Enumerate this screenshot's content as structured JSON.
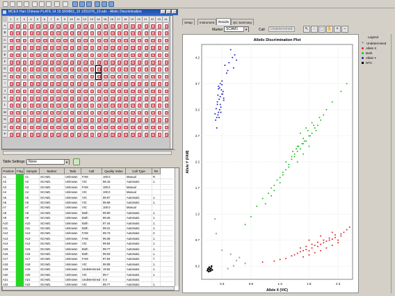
{
  "window_title": "MCEX Han Chinese PLATE 14 15 SR0862_10 1251076_10.sds - Allelic Discrimination",
  "toolbar_icons": [
    "new-icon",
    "open-icon",
    "save-icon",
    "print-icon",
    "copy-icon",
    "cut-icon",
    "paste-icon",
    "run-icon",
    "analyze-icon",
    "plate-view-icon",
    "detector-icon",
    "results-icon",
    "table-view-icon",
    "grid-view-icon",
    "plot-view-icon"
  ],
  "plate": {
    "columns": [
      "1",
      "2",
      "3",
      "4",
      "5",
      "6",
      "7",
      "8",
      "9",
      "10",
      "11",
      "12",
      "13",
      "14",
      "15",
      "16",
      "17",
      "18",
      "19",
      "20",
      "21",
      "22",
      "23",
      "24"
    ],
    "rows": [
      "A",
      "B",
      "C",
      "D",
      "E",
      "F",
      "G",
      "H",
      "I",
      "J",
      "K",
      "L",
      "M",
      "N",
      "O",
      "P"
    ],
    "well_label": "U",
    "well_color": "#ef9aa0",
    "selected_wells": [
      "G14",
      "H14"
    ]
  },
  "table_settings": {
    "label": "Table Settings:",
    "value": "None"
  },
  "table": {
    "headers": [
      "Position",
      "Flag",
      "Sample",
      "Marker",
      "Task",
      "Call",
      "Quality Value",
      "Call Type",
      "Re"
    ],
    "rows": [
      [
        "A1",
        "",
        "A1",
        "SCAM1",
        "Unknown",
        "FAM",
        "100.0",
        "Manual",
        "R"
      ],
      [
        "A2",
        "",
        "A2",
        "SCAM1",
        "Unknown",
        "VIC",
        "98.16",
        "Automatic",
        "1."
      ],
      [
        "A3",
        "",
        "A3",
        "SCAM1",
        "Unknown",
        "FAM",
        "100.0",
        "Manual",
        ""
      ],
      [
        "A4",
        "",
        "A4",
        "SCAM1",
        "Unknown",
        "VIC",
        "100.0",
        "Manual",
        ""
      ],
      [
        "A5",
        "",
        "A5",
        "SCAM1",
        "Unknown",
        "VIC",
        "99.97",
        "Automatic",
        "1."
      ],
      [
        "A6",
        "",
        "A6",
        "SCAM1",
        "Unknown",
        "VIC",
        "98.69",
        "Automatic",
        "1."
      ],
      [
        "A7",
        "",
        "A7",
        "SCAM1",
        "Unknown",
        "VIC",
        "100.0",
        "Manual",
        ""
      ],
      [
        "A8",
        "",
        "A8",
        "SCAM1",
        "Unknown",
        "Both",
        "99.90",
        "Automatic",
        "1."
      ],
      [
        "A9",
        "",
        "A9",
        "SCAM1",
        "Unknown",
        "Both",
        "99.26",
        "Automatic",
        "1."
      ],
      [
        "A10",
        "",
        "A10",
        "SCAM1",
        "Unknown",
        "Both",
        "97.44",
        "Automatic",
        "1."
      ],
      [
        "A11",
        "",
        "A11",
        "SCAM1",
        "Unknown",
        "Both",
        "99.21",
        "Automatic",
        "1."
      ],
      [
        "A12",
        "",
        "A12",
        "SCAM1",
        "Unknown",
        "FAM",
        "99.73",
        "Automatic",
        "2."
      ],
      [
        "A13",
        "",
        "A13",
        "SCAM1",
        "Unknown",
        "FAM",
        "99.39",
        "Automatic",
        "1."
      ],
      [
        "A14",
        "",
        "A14",
        "SCAM1",
        "Unknown",
        "VIC",
        "99.84",
        "Automatic",
        "1."
      ],
      [
        "A15",
        "",
        "A15",
        "SCAM1",
        "Unknown",
        "Both",
        "99.77",
        "Automatic",
        "1."
      ],
      [
        "A16",
        "",
        "A16",
        "SCAM1",
        "Unknown",
        "Both",
        "99.03",
        "Automatic",
        "1."
      ],
      [
        "A17",
        "",
        "A17",
        "SCAM1",
        "Unknown",
        "FAM",
        "97.84",
        "Automatic",
        "7."
      ],
      [
        "A18",
        "",
        "A18",
        "SCAM1",
        "Unknown",
        "VIC",
        "99.09",
        "Automatic",
        "1."
      ],
      [
        "A19",
        "",
        "A19",
        "SCAM1",
        "Unknown",
        "Undetermined",
        "19.62",
        "Automatic",
        "1."
      ],
      [
        "A20",
        "",
        "A20",
        "SCAM1",
        "Unknown",
        "VIC",
        "99.7",
        "Automatic",
        "1."
      ],
      [
        "A21",
        "",
        "A21",
        "SCAM1",
        "Unknown",
        "Undetermined",
        "0.0",
        "Automatic",
        ""
      ],
      [
        "A22",
        "",
        "A22",
        "SCAM1",
        "Unknown",
        "VIC",
        "99.77",
        "Automatic",
        "1."
      ],
      [
        "A23",
        "",
        "A23",
        "SCAM1",
        "Unknown",
        "FAM",
        "100.0",
        "Manual",
        "1."
      ]
    ]
  },
  "tabs": [
    "Setup",
    "Instrument",
    "Results",
    "QC Summary"
  ],
  "active_tab": "Results",
  "marker": {
    "label": "Marker",
    "value": "SCAM1"
  },
  "call": {
    "label": "Call",
    "value": "Undetermined"
  },
  "plot_tools": [
    "pointer-icon",
    "lasso-icon",
    "box-select-icon",
    "hand-icon",
    "zoom-in-icon",
    "zoom-out-icon"
  ],
  "legend": {
    "title": "Legend",
    "items": [
      {
        "label": "Undetermined",
        "symbol": "x",
        "color": "#444444"
      },
      {
        "label": "Allele X",
        "symbol": "dot",
        "color": "#e02020"
      },
      {
        "label": "Both",
        "symbol": "dot",
        "color": "#20c020"
      },
      {
        "label": "Allele Y",
        "symbol": "dot",
        "color": "#2020c0"
      },
      {
        "label": "NTC",
        "symbol": "square",
        "color": "#000000"
      }
    ]
  },
  "chart_data": {
    "type": "scatter",
    "title": "Allelic Discrimination Plot",
    "xlabel": "Allele X (VIC)",
    "ylabel": "Allele Y (FAM)",
    "xlim": [
      -0.05,
      2.55
    ],
    "ylim": [
      -0.05,
      4.45
    ],
    "xticks": [
      "0.3",
      "0.8",
      "1.3",
      "1.8",
      "2.3"
    ],
    "yticks": [
      "0.2",
      "0.7",
      "1.2",
      "1.7",
      "2.2",
      "2.7",
      "3.2",
      "3.7",
      "4.2"
    ],
    "series": [
      {
        "name": "Allele Y",
        "color": "#2020c0",
        "x": [
          0.19,
          0.21,
          0.23,
          0.24,
          0.26,
          0.28,
          0.22,
          0.25,
          0.27,
          0.3,
          0.32,
          0.24,
          0.26,
          0.29,
          0.31,
          0.33,
          0.22,
          0.2,
          0.18,
          0.24,
          0.27,
          0.3,
          0.35,
          0.42,
          0.45,
          0.52,
          0.48,
          0.38,
          0.4,
          0.25,
          0.28,
          0.33,
          0.21,
          0.23,
          0.3,
          0.27,
          0.5,
          0.55
        ],
        "y": [
          3.0,
          3.05,
          3.1,
          3.15,
          3.2,
          3.25,
          3.35,
          3.4,
          3.45,
          3.5,
          3.55,
          3.6,
          3.62,
          3.58,
          3.5,
          3.42,
          3.3,
          3.22,
          3.12,
          3.65,
          3.7,
          3.75,
          4.05,
          4.1,
          4.35,
          4.25,
          4.2,
          3.9,
          3.95,
          3.05,
          3.15,
          3.38,
          2.85,
          3.48,
          3.68,
          3.3,
          4.0,
          4.15
        ]
      },
      {
        "name": "Both",
        "color": "#20c020",
        "x": [
          0.9,
          1.0,
          1.1,
          1.15,
          1.2,
          1.25,
          1.3,
          1.35,
          1.4,
          1.45,
          1.5,
          1.55,
          1.6,
          1.65,
          1.7,
          1.75,
          1.8,
          1.85,
          1.9,
          1.95,
          2.0,
          2.05,
          1.4,
          1.5,
          1.6,
          1.7,
          1.65,
          1.75,
          1.85,
          1.55,
          1.45,
          1.58,
          1.68,
          1.78,
          1.88,
          1.98,
          1.72,
          1.62,
          1.52,
          1.82,
          1.92,
          2.1,
          2.2,
          2.35,
          2.45,
          0.7,
          0.8,
          1.05,
          1.2,
          1.3,
          1.15,
          1.35,
          1.6,
          1.7,
          1.8
        ],
        "y": [
          1.35,
          1.5,
          1.6,
          1.7,
          1.75,
          1.85,
          1.9,
          2.0,
          2.05,
          2.15,
          2.25,
          2.3,
          2.4,
          2.45,
          2.55,
          2.6,
          2.7,
          2.75,
          2.85,
          2.9,
          3.0,
          3.1,
          2.2,
          2.3,
          2.5,
          2.65,
          2.75,
          2.85,
          2.95,
          2.35,
          2.1,
          2.45,
          2.55,
          2.8,
          2.9,
          3.05,
          2.6,
          2.5,
          2.4,
          2.7,
          2.8,
          3.2,
          3.35,
          3.55,
          3.7,
          1.0,
          1.15,
          1.4,
          1.65,
          1.8,
          1.55,
          1.95,
          2.2,
          2.35,
          2.5
        ]
      },
      {
        "name": "Allele X",
        "color": "#e02020",
        "x": [
          1.55,
          1.6,
          1.65,
          1.7,
          1.75,
          1.8,
          1.85,
          1.9,
          1.95,
          2.0,
          2.05,
          2.1,
          2.15,
          2.2,
          2.25,
          2.3,
          2.35,
          1.7,
          1.8,
          1.9,
          2.0,
          2.1,
          2.2,
          2.3,
          1.75,
          1.85,
          1.95,
          2.05,
          2.15,
          2.25,
          2.35,
          2.4,
          1.65,
          1.8,
          2.0,
          2.2,
          2.45,
          1.4,
          1.5,
          1.2,
          1.0,
          1.3,
          2.5
        ],
        "y": [
          0.42,
          0.45,
          0.48,
          0.5,
          0.52,
          0.5,
          0.55,
          0.6,
          0.58,
          0.62,
          0.65,
          0.68,
          0.7,
          0.72,
          0.75,
          0.7,
          0.78,
          0.38,
          0.42,
          0.46,
          0.5,
          0.55,
          0.6,
          0.65,
          0.58,
          0.62,
          0.66,
          0.7,
          0.74,
          0.8,
          0.82,
          0.85,
          0.55,
          0.7,
          0.78,
          0.85,
          0.9,
          0.35,
          0.4,
          0.3,
          0.28,
          0.33,
          0.95
        ]
      },
      {
        "name": "NTC",
        "color": "#000000",
        "x": [
          0.05,
          0.07,
          0.09,
          0.11,
          0.08,
          0.1,
          0.12,
          0.06,
          0.13
        ],
        "y": [
          0.12,
          0.1,
          0.14,
          0.16,
          0.18,
          0.11,
          0.2,
          0.15,
          0.13
        ]
      },
      {
        "name": "Undetermined",
        "color": "#444444",
        "x": [
          0.5,
          0.55,
          0.45,
          0.6,
          0.2,
          0.18,
          0.7,
          0.3,
          0.4
        ],
        "y": [
          0.2,
          0.3,
          0.42,
          0.36,
          0.82,
          1.1,
          0.25,
          0.5,
          0.15
        ]
      }
    ]
  }
}
